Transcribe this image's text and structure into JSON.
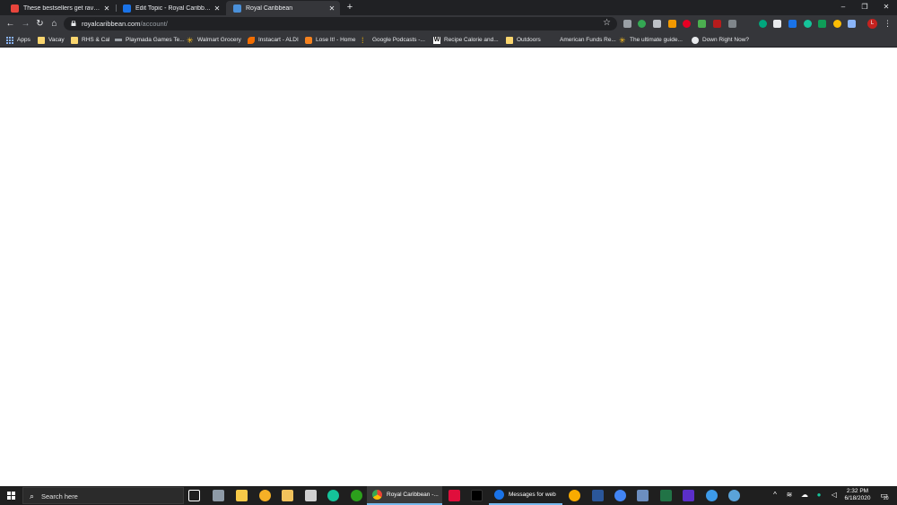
{
  "tabs": [
    {
      "title": "These bestsellers get rave reviews",
      "favicon_color": "#e8453c",
      "active": false
    },
    {
      "title": "Edit Topic - Royal Caribbean Blog",
      "favicon_color": "#1a73e8",
      "active": false
    },
    {
      "title": "Royal Caribbean",
      "favicon_color": "#4a90d9",
      "active": true
    }
  ],
  "toolbar": {
    "url_host": "royalcaribbean.com",
    "url_path": "/account/"
  },
  "bookmarks": [
    {
      "label": "Apps",
      "icon": "apps-grid-icon"
    },
    {
      "label": "Vacay",
      "icon": "folder-icon"
    },
    {
      "label": "RHS & Cal",
      "icon": "folder-icon"
    },
    {
      "label": "Playmada Games Te...",
      "icon": "playmada-icon"
    },
    {
      "label": "Walmart Grocery",
      "icon": "walmart-spark-icon"
    },
    {
      "label": "Instacart - ALDI",
      "icon": "instacart-carrot-icon"
    },
    {
      "label": "Lose It! - Home",
      "icon": "loseit-icon"
    },
    {
      "label": "Google Podcasts -...",
      "icon": "google-podcasts-icon"
    },
    {
      "label": "Recipe Calorie and...",
      "icon": "w-icon"
    },
    {
      "label": "Outdoors",
      "icon": "folder-icon"
    },
    {
      "label": "American Funds Re...",
      "icon": "american-funds-icon"
    },
    {
      "label": "The ultimate guide...",
      "icon": "walmart-spark-icon"
    },
    {
      "label": "Down Right Now?",
      "icon": "globe-icon"
    }
  ],
  "taskbar": {
    "search_placeholder": "Search here",
    "apps": [
      {
        "label": "Royal Caribbean -...",
        "icon": "chrome-icon",
        "active": true
      },
      {
        "label": "Messages for web",
        "icon": "messages-icon",
        "active": false
      }
    ],
    "time": "2:32 PM",
    "date": "6/18/2020",
    "notifications": "20"
  },
  "colors": {
    "tabstrip": "#202124",
    "toolbar": "#35363a",
    "taskbar": "#1f1f1f",
    "accent": "#76b9ed"
  }
}
